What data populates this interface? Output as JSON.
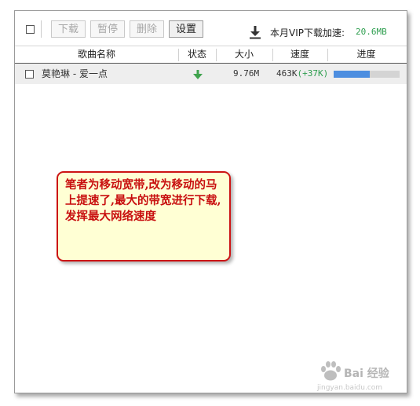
{
  "toolbar": {
    "buttons": [
      "下载",
      "暂停",
      "删除",
      "设置"
    ],
    "vip_label": "本月VIP下载加速:",
    "vip_value": "20.6MB"
  },
  "table": {
    "columns": [
      "歌曲名称",
      "状态",
      "大小",
      "速度",
      "进度"
    ],
    "rows": [
      {
        "name": "莫艳琳 - 爱一点",
        "status_icon": "down-arrow-icon",
        "size": "9.76M",
        "speed": "463K",
        "speed_boost": "(+37K)",
        "progress_fraction": 0.55
      }
    ]
  },
  "annotation": {
    "text": "笔者为移动宽带,改为移动的马上提速了,最大的带宽进行下载,发挥最大网络速度"
  },
  "watermark": {
    "text": "Bai 经验",
    "sub": "jingyan.baidu.com"
  },
  "colors": {
    "accent_green": "#2e9e4f",
    "progress_blue": "#4d8ee0",
    "note_red": "#cc1414",
    "note_bg": "#ffffd4"
  }
}
